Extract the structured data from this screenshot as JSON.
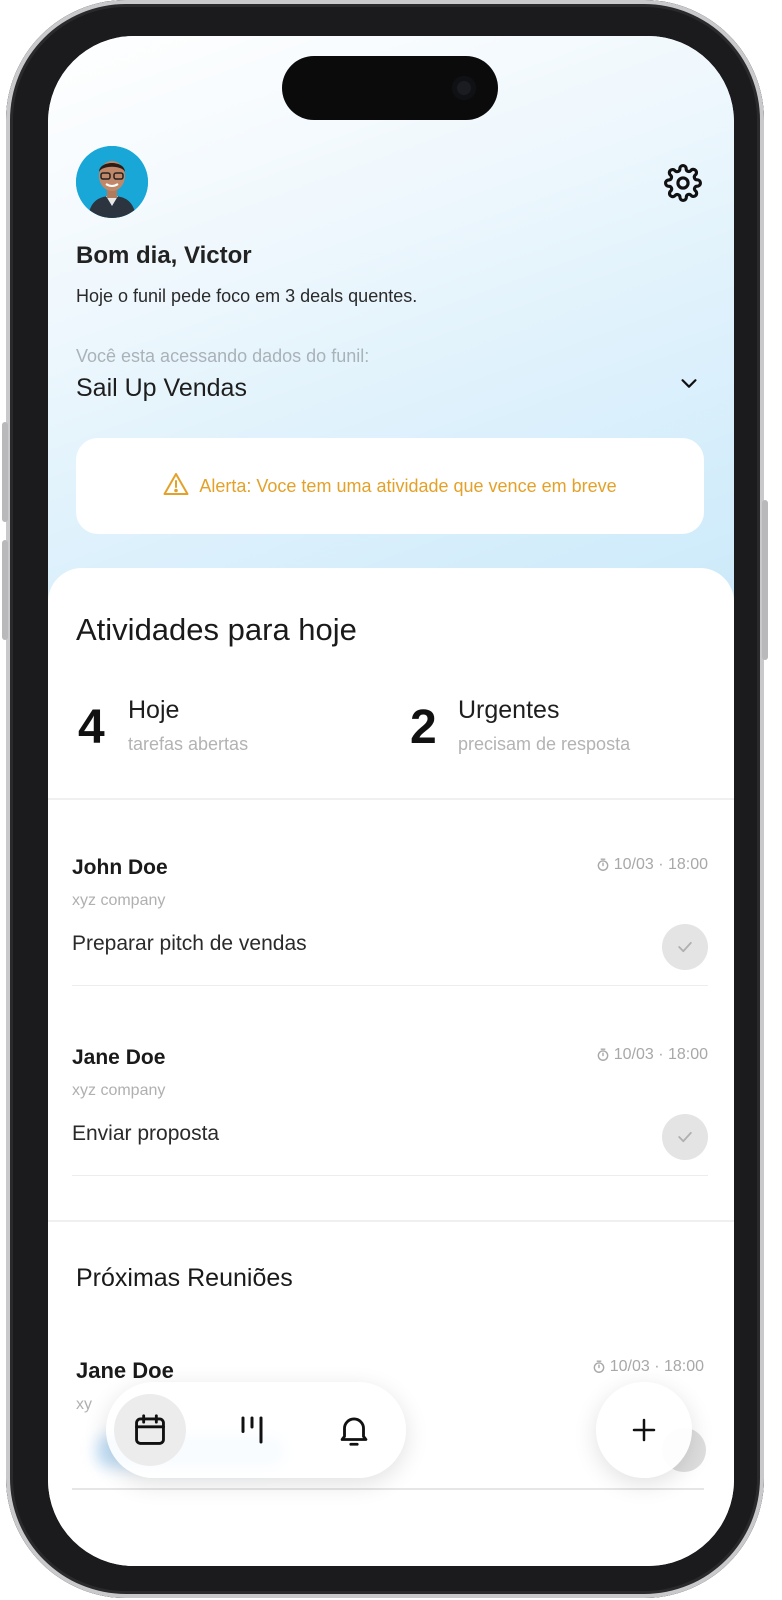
{
  "header": {
    "greeting": "Bom dia, Victor",
    "subtitle": "Hoje o funil pede foco em 3 deals quentes.",
    "funnel_hint": "Você esta acessando dados do funil:",
    "funnel_name": "Sail Up Vendas"
  },
  "alert": {
    "text": "Alerta: Voce tem uma atividade que vence em breve",
    "color": "#e4a12a"
  },
  "activities": {
    "title": "Atividades para hoje",
    "stats": [
      {
        "number": "4",
        "label": "Hoje",
        "sub": "tarefas abertas"
      },
      {
        "number": "2",
        "label": "Urgentes",
        "sub": "precisam de resposta"
      }
    ],
    "items": [
      {
        "name": "John Doe",
        "company": "xyz company",
        "task": "Preparar pitch de vendas",
        "time": "10/03 · 18:00"
      },
      {
        "name": "Jane Doe",
        "company": "xyz company",
        "task": "Enviar proposta",
        "time": "10/03 · 18:00"
      }
    ]
  },
  "meetings": {
    "title": "Próximas Reuniões",
    "items": [
      {
        "name": "Jane Doe",
        "company": "xy",
        "time": "10/03 · 18:00"
      }
    ]
  },
  "nav": {
    "items": [
      {
        "icon": "calendar-icon",
        "active": true
      },
      {
        "icon": "kanban-icon",
        "active": false
      },
      {
        "icon": "bell-icon",
        "active": false
      }
    ],
    "fab_icon": "plus-icon"
  }
}
